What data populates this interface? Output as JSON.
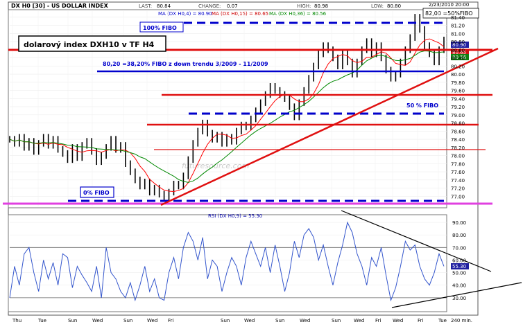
{
  "header": {
    "symbol": "DX H0 [30] - US DOLLAR INDEX",
    "last_label": "LAST:",
    "last_value": "80.84",
    "change_label": "CHANGE:",
    "change_value": "0.07",
    "high_label": "HIGH:",
    "high_value": "80.98",
    "low_label": "LOW:",
    "low_value": "80.80",
    "datetime": "2/23/2010 20:00"
  },
  "ma_legend": {
    "ma4": "MA (DX H0,4) = 80.90",
    "ma15": "MA (DX H0,15) = 80.65",
    "ma36": "MA (DX H0,36) = 80.56"
  },
  "annotations": {
    "fibo100": "100% FIBO",
    "fibo0": "0% FIBO",
    "fibo50": "50 % FIBO",
    "fibo_top": "82,00 =50%FIBO",
    "title_box": "dolarový index DXH10 v TF H4",
    "fibo382": "80,20 =38,20% FIBO z down trendu  3/2009 - 11/2009",
    "watermark": "futuresource.com"
  },
  "price_badges": {
    "ma4": "80.90",
    "ma15": "80.65",
    "ma36": "80.56"
  },
  "rsi_badge": "55.30",
  "colors": {
    "price_line": "#000000",
    "ma4": "#ff0000",
    "ma15": "#ff0000",
    "ma36": "#008800",
    "rsi": "#3355cc",
    "fibo_dashed": "#0000cc",
    "support_red": "#e01010",
    "magenta": "#e040e0",
    "badge_ma4": "#2020a0",
    "badge_ma15": "#d01010",
    "badge_ma36": "#108010"
  },
  "chart_data": [
    {
      "type": "line",
      "title": "DX H0 [30] - US DOLLAR INDEX",
      "ylim": [
        76.75,
        81.55
      ],
      "yticks": [
        77.0,
        77.2,
        77.4,
        77.6,
        77.8,
        78.0,
        78.2,
        78.4,
        78.6,
        78.8,
        79.0,
        79.2,
        79.4,
        79.6,
        79.8,
        80.0,
        80.2,
        80.4,
        80.6,
        80.8,
        81.0,
        81.2,
        81.4
      ],
      "x_labels": [
        "Thu",
        "Tue",
        "Sun",
        "Wed",
        "Sun",
        "Wed",
        "Fri",
        "Sun",
        "Wed",
        "Sun",
        "Wed",
        "Sun",
        "Wed",
        "Fri",
        "Wed",
        "Fri",
        "Tue",
        "240 min."
      ],
      "series": [
        {
          "values": [
            78.4,
            78.3,
            78.45,
            78.2,
            78.35,
            78.1,
            78.3,
            78.45,
            78.25,
            78.4,
            78.15,
            78.05,
            77.9,
            78.2,
            77.95,
            78.25,
            78.35,
            78.1,
            77.85,
            78.0,
            78.2,
            78.4,
            78.15,
            78.25,
            77.8,
            77.6,
            77.4,
            77.25,
            77.35,
            77.1,
            77.2,
            77.05,
            76.95,
            77.1,
            77.3,
            77.25,
            77.5,
            77.9,
            78.3,
            78.6,
            78.8,
            78.55,
            78.4,
            78.5,
            78.3,
            78.45,
            78.35,
            78.6,
            78.75,
            78.7,
            78.9,
            79.1,
            79.3,
            79.5,
            79.7,
            79.6,
            79.5,
            79.4,
            79.2,
            78.95,
            79.3,
            79.6,
            79.9,
            80.2,
            80.5,
            80.7,
            80.6,
            80.4,
            80.2,
            80.5,
            80.3,
            80.0,
            80.3,
            80.6,
            80.8,
            80.5,
            80.7,
            80.4,
            80.1,
            79.9,
            80.0,
            80.3,
            80.6,
            80.9,
            81.4,
            81.1,
            80.7,
            80.5,
            80.3,
            80.6,
            80.84
          ]
        }
      ]
    },
    {
      "type": "line",
      "title": "RSI (DX H0,9) = 55.30",
      "ylim": [
        20,
        95
      ],
      "yticks": [
        30,
        40,
        50,
        60,
        70,
        80,
        90
      ],
      "series": [
        {
          "values": [
            30,
            55,
            40,
            65,
            70,
            50,
            35,
            60,
            45,
            58,
            40,
            65,
            62,
            38,
            55,
            48,
            42,
            35,
            55,
            30,
            70,
            50,
            45,
            35,
            30,
            42,
            28,
            40,
            55,
            35,
            45,
            30,
            28,
            50,
            62,
            45,
            70,
            82,
            75,
            60,
            78,
            45,
            60,
            55,
            35,
            50,
            62,
            55,
            40,
            62,
            75,
            65,
            55,
            70,
            50,
            72,
            55,
            35,
            50,
            75,
            62,
            80,
            85,
            78,
            60,
            72,
            55,
            40,
            58,
            72,
            90,
            82,
            65,
            55,
            40,
            62,
            55,
            70,
            48,
            28,
            38,
            55,
            75,
            68,
            72,
            55,
            45,
            40,
            50,
            65,
            55
          ]
        }
      ]
    }
  ]
}
